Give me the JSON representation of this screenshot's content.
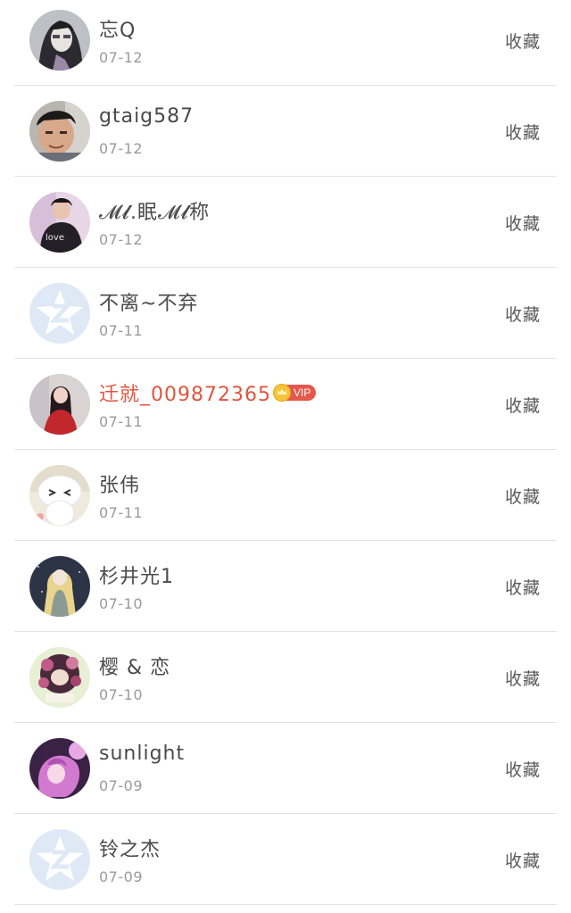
{
  "items": [
    {
      "name": "忘Q",
      "date": "07-12",
      "action": "收藏",
      "avatar": "grayscale-portrait"
    },
    {
      "name": "gtaig587",
      "date": "07-12",
      "action": "收藏",
      "avatar": "photo-face"
    },
    {
      "name": "𝓜𝓵.眠𝓜𝓵称",
      "date": "07-12",
      "action": "收藏",
      "avatar": "boy-shirt"
    },
    {
      "name": "不离~不弃",
      "date": "07-11",
      "action": "收藏",
      "avatar": "default-qq"
    },
    {
      "name": "迁就_009872365",
      "date": "07-11",
      "action": "收藏",
      "avatar": "girl-red",
      "vip": true,
      "vip_label": "VIP"
    },
    {
      "name": "张伟",
      "date": "07-11",
      "action": "收藏",
      "avatar": "white-cartoon"
    },
    {
      "name": "杉井光1",
      "date": "07-10",
      "action": "收藏",
      "avatar": "anime-girl"
    },
    {
      "name": "樱 & 恋",
      "date": "07-10",
      "action": "收藏",
      "avatar": "flower-circle"
    },
    {
      "name": "sunlight",
      "date": "07-09",
      "action": "收藏",
      "avatar": "pink-anime"
    },
    {
      "name": "铃之杰",
      "date": "07-09",
      "action": "收藏",
      "avatar": "default-qq"
    }
  ],
  "colors": {
    "vip_name": "#e0553e",
    "vip_tag": "#e4574b",
    "divider": "#e3e3e3",
    "qq_default": "#dfe9f6"
  }
}
